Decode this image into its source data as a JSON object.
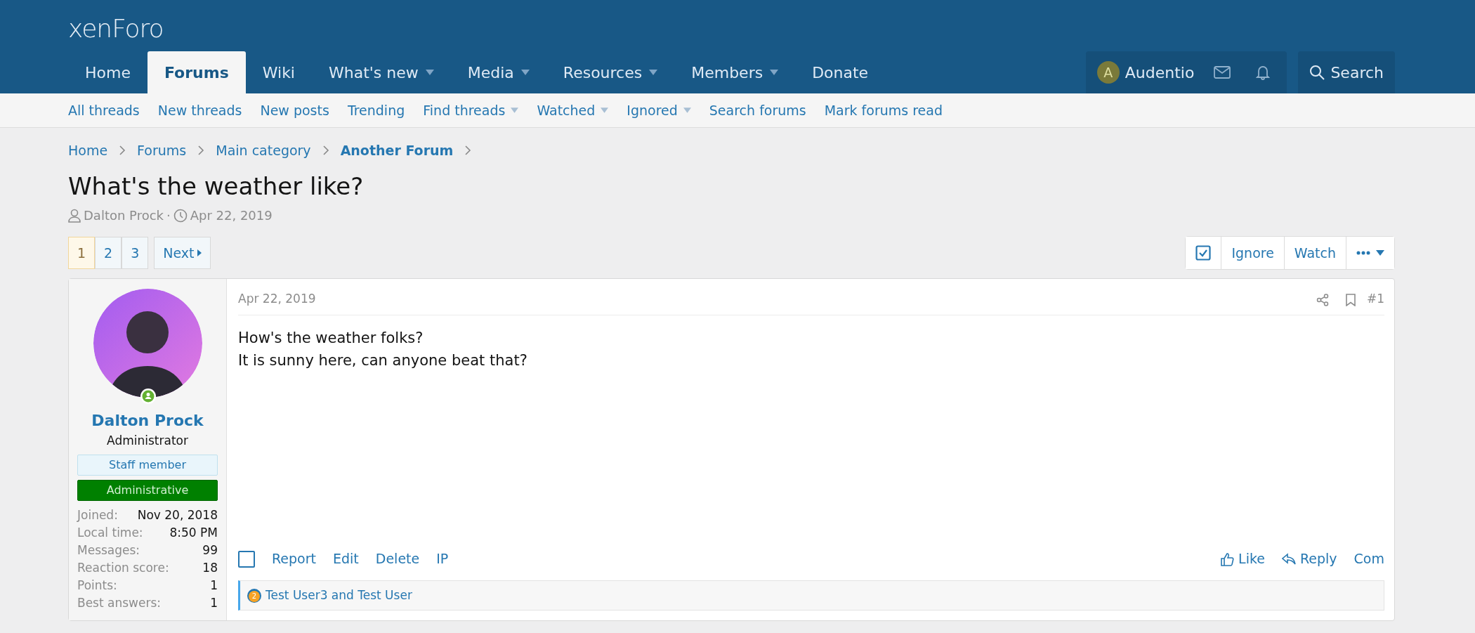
{
  "logo": "xenForo",
  "nav": [
    {
      "label": "Home",
      "selected": false,
      "dropdown": false
    },
    {
      "label": "Forums",
      "selected": true,
      "dropdown": false
    },
    {
      "label": "Wiki",
      "selected": false,
      "dropdown": false
    },
    {
      "label": "What's new",
      "selected": false,
      "dropdown": true
    },
    {
      "label": "Media",
      "selected": false,
      "dropdown": true
    },
    {
      "label": "Resources",
      "selected": false,
      "dropdown": true
    },
    {
      "label": "Members",
      "selected": false,
      "dropdown": true
    },
    {
      "label": "Donate",
      "selected": false,
      "dropdown": false
    }
  ],
  "account": {
    "initial": "A",
    "name": "Audentio"
  },
  "search_label": "Search",
  "subnav": [
    {
      "label": "All threads",
      "dropdown": false
    },
    {
      "label": "New threads",
      "dropdown": false
    },
    {
      "label": "New posts",
      "dropdown": false
    },
    {
      "label": "Trending",
      "dropdown": false
    },
    {
      "label": "Find threads",
      "dropdown": true
    },
    {
      "label": "Watched",
      "dropdown": true
    },
    {
      "label": "Ignored",
      "dropdown": true
    },
    {
      "label": "Search forums",
      "dropdown": false
    },
    {
      "label": "Mark forums read",
      "dropdown": false
    }
  ],
  "breadcrumbs": [
    {
      "label": "Home",
      "current": false
    },
    {
      "label": "Forums",
      "current": false
    },
    {
      "label": "Main category",
      "current": false
    },
    {
      "label": "Another Forum",
      "current": true
    }
  ],
  "title": "What's the weather like?",
  "meta": {
    "author": "Dalton Prock",
    "separator": "·",
    "date": "Apr 22, 2019"
  },
  "pagination": {
    "pages": [
      {
        "label": "1",
        "selected": true
      },
      {
        "label": "2",
        "selected": false
      },
      {
        "label": "3",
        "selected": false
      }
    ],
    "next": "Next"
  },
  "thread_actions": [
    {
      "kind": "select"
    },
    {
      "kind": "text",
      "label": "Ignore"
    },
    {
      "kind": "text",
      "label": "Watch"
    },
    {
      "kind": "more"
    }
  ],
  "post": {
    "user": {
      "name": "Dalton Prock",
      "role": "Administrator",
      "online": true,
      "banners": [
        {
          "label": "Staff member",
          "kind": "staff"
        },
        {
          "label": "Administrative",
          "kind": "admin"
        }
      ],
      "stats": [
        {
          "label": "Joined:",
          "value": "Nov 20, 2018"
        },
        {
          "label": "Local time:",
          "value": "8:50 PM"
        },
        {
          "label": "Messages:",
          "value": "99"
        },
        {
          "label": "Reaction score:",
          "value": "18"
        },
        {
          "label": "Points:",
          "value": "1"
        },
        {
          "label": "Best answers:",
          "value": "1"
        }
      ]
    },
    "date": "Apr 22, 2019",
    "number": "#1",
    "body": [
      "How's the weather folks?",
      "It is sunny here, can anyone beat that?"
    ],
    "checked": false,
    "actions_left": [
      "Report",
      "Edit",
      "Delete",
      "IP"
    ],
    "actions_right": [
      {
        "kind": "like",
        "label": "Like"
      },
      {
        "kind": "reply",
        "label": "Reply"
      },
      {
        "kind": "text",
        "label": "Com"
      }
    ],
    "reactions": {
      "count": "2",
      "text": "Test User3 and Test User"
    }
  }
}
